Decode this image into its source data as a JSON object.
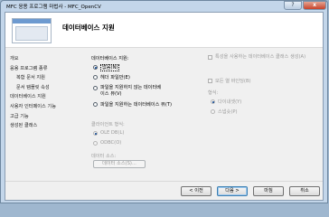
{
  "window": {
    "title": "MFC 응용 프로그램 마법사 - MFC_OpenCV",
    "help_glyph": "?",
    "close_glyph": "x"
  },
  "header": {
    "title": "데이터베이스 지원"
  },
  "nav": {
    "items": [
      "개요",
      "응용 프로그램 종류",
      "복합 문서 지원",
      "문서 템플릿 속성",
      "데이터베이스 지원",
      "사용자 인터페이스 기능",
      "고급 기능",
      "생성된 클래스"
    ]
  },
  "database_support": {
    "label": "데이터베이스 지원:",
    "options": [
      "없음(N)",
      "헤더 파일만(E)",
      "파일을 지원하지 않는 데이터베이스 뷰(V)",
      "파일을 지원하는 데이터베이스 뷰(T)"
    ],
    "selected": 0
  },
  "client_type": {
    "label": "클라이언트 형식:",
    "options": [
      "OLE DB(L)",
      "ODBC(O)"
    ]
  },
  "data_source": {
    "label": "데이터 소스:",
    "button": "데이터 소스(S)..."
  },
  "right_options": {
    "dynamic_columns": "특성을 사용하는 데이터베이스 클래스 생성(A)",
    "bind_all": "모든 열 바인딩(B)",
    "type_label": "형식:",
    "types": [
      "다이내셋(Y)",
      "스냅숏(P)"
    ]
  },
  "footer": {
    "prev": "< 이전",
    "next": "다음 >",
    "finish": "마침",
    "cancel": "취소"
  }
}
